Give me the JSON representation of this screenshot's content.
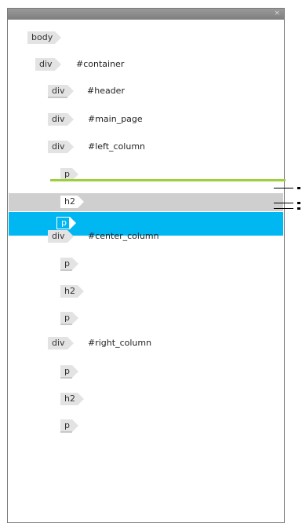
{
  "window": {
    "close_label": "×"
  },
  "tree": [
    {
      "tag": "body",
      "id": ""
    },
    {
      "tag": "div",
      "id": "#container"
    },
    {
      "tag": "div",
      "id": "#header"
    },
    {
      "tag": "div",
      "id": "#main_page"
    },
    {
      "tag": "div",
      "id": "#left_column"
    },
    {
      "tag": "p",
      "id": ""
    },
    {
      "tag": "h2",
      "id": ""
    },
    {
      "tag": "p",
      "id": ""
    },
    {
      "tag": "div",
      "id": "#center_column"
    },
    {
      "tag": "p",
      "id": ""
    },
    {
      "tag": "h2",
      "id": ""
    },
    {
      "tag": "p",
      "id": ""
    },
    {
      "tag": "div",
      "id": "#right_column"
    },
    {
      "tag": "p",
      "id": ""
    },
    {
      "tag": "h2",
      "id": ""
    },
    {
      "tag": "p",
      "id": ""
    }
  ],
  "colors": {
    "selected_row": "#00b7f2",
    "hover_row": "#cfcfcf",
    "drop_indicator": "#9ccf3a",
    "tag_bg": "#e3e3e3",
    "titlebar": "#8a8a8a"
  }
}
